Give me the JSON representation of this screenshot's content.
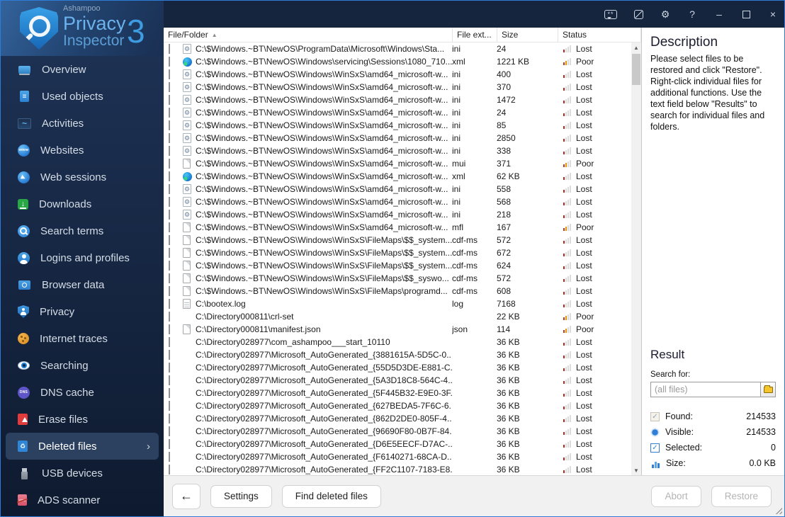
{
  "logo": {
    "brand_top": "Ashampoo",
    "brand_main": "Privacy",
    "brand_sub": "Inspector",
    "brand_version": "3"
  },
  "titlebar": {
    "feedback_glyph": "**",
    "settings_glyph": "⚙",
    "help_glyph": "?",
    "minimize_glyph": "–",
    "close_glyph": "×"
  },
  "sidebar": {
    "chevron": "›",
    "items": [
      {
        "label": "Overview",
        "icon": "laptop",
        "glyph": "",
        "selected": false
      },
      {
        "label": "Used objects",
        "icon": "docblue",
        "glyph": "",
        "selected": false
      },
      {
        "label": "Activities",
        "icon": "activities",
        "glyph": "",
        "selected": false
      },
      {
        "label": "Websites",
        "icon": "www",
        "glyph": "www",
        "selected": false
      },
      {
        "label": "Web sessions",
        "icon": "cursor",
        "glyph": "",
        "selected": false
      },
      {
        "label": "Downloads",
        "icon": "download",
        "glyph": "↓",
        "selected": false
      },
      {
        "label": "Search terms",
        "icon": "search-s",
        "glyph": "",
        "selected": false
      },
      {
        "label": "Logins and profiles",
        "icon": "person",
        "glyph": "",
        "selected": false
      },
      {
        "label": "Browser data",
        "icon": "camera",
        "glyph": "",
        "selected": false
      },
      {
        "label": "Privacy",
        "icon": "shield-p",
        "glyph": "",
        "selected": false
      },
      {
        "label": "Internet traces",
        "icon": "cookie",
        "glyph": "",
        "selected": false
      },
      {
        "label": "Searching",
        "icon": "eye",
        "glyph": "",
        "selected": false
      },
      {
        "label": "DNS cache",
        "icon": "dns",
        "glyph": "DNS",
        "selected": false
      },
      {
        "label": "Erase files",
        "icon": "erase",
        "glyph": "",
        "selected": false
      },
      {
        "label": "Deleted files",
        "icon": "trash-b",
        "glyph": "♻",
        "selected": true
      },
      {
        "label": "USB devices",
        "icon": "usb",
        "glyph": "",
        "selected": false
      },
      {
        "label": "ADS scanner",
        "icon": "ads",
        "glyph": "ADS",
        "selected": false
      }
    ]
  },
  "table": {
    "columns": [
      {
        "label": "File/Folder",
        "sort": "▲"
      },
      {
        "label": "File ext..."
      },
      {
        "label": "Size"
      },
      {
        "label": "Status"
      }
    ],
    "rows": [
      {
        "path": "C:\\$Windows.~BT\\NewOS\\ProgramData\\Microsoft\\Windows\\Sta...",
        "icon": "gear",
        "ext": "ini",
        "size": "24",
        "status": "Lost"
      },
      {
        "path": "C:\\$Windows.~BT\\NewOS\\Windows\\servicing\\Sessions\\1080_710...",
        "icon": "edge",
        "ext": "xml",
        "size": "1221 KB",
        "status": "Poor"
      },
      {
        "path": "C:\\$Windows.~BT\\NewOS\\Windows\\WinSxS\\amd64_microsoft-w...",
        "icon": "gear",
        "ext": "ini",
        "size": "400",
        "status": "Lost"
      },
      {
        "path": "C:\\$Windows.~BT\\NewOS\\Windows\\WinSxS\\amd64_microsoft-w...",
        "icon": "gear",
        "ext": "ini",
        "size": "370",
        "status": "Lost"
      },
      {
        "path": "C:\\$Windows.~BT\\NewOS\\Windows\\WinSxS\\amd64_microsoft-w...",
        "icon": "gear",
        "ext": "ini",
        "size": "1472",
        "status": "Lost"
      },
      {
        "path": "C:\\$Windows.~BT\\NewOS\\Windows\\WinSxS\\amd64_microsoft-w...",
        "icon": "gear",
        "ext": "ini",
        "size": "24",
        "status": "Lost"
      },
      {
        "path": "C:\\$Windows.~BT\\NewOS\\Windows\\WinSxS\\amd64_microsoft-w...",
        "icon": "gear",
        "ext": "ini",
        "size": "85",
        "status": "Lost"
      },
      {
        "path": "C:\\$Windows.~BT\\NewOS\\Windows\\WinSxS\\amd64_microsoft-w...",
        "icon": "gear",
        "ext": "ini",
        "size": "2850",
        "status": "Lost"
      },
      {
        "path": "C:\\$Windows.~BT\\NewOS\\Windows\\WinSxS\\amd64_microsoft-w...",
        "icon": "gear",
        "ext": "ini",
        "size": "338",
        "status": "Lost"
      },
      {
        "path": "C:\\$Windows.~BT\\NewOS\\Windows\\WinSxS\\amd64_microsoft-w...",
        "icon": "doc",
        "ext": "mui",
        "size": "371",
        "status": "Poor"
      },
      {
        "path": "C:\\$Windows.~BT\\NewOS\\Windows\\WinSxS\\amd64_microsoft-w...",
        "icon": "edge",
        "ext": "xml",
        "size": "62 KB",
        "status": "Lost"
      },
      {
        "path": "C:\\$Windows.~BT\\NewOS\\Windows\\WinSxS\\amd64_microsoft-w...",
        "icon": "gear",
        "ext": "ini",
        "size": "558",
        "status": "Lost"
      },
      {
        "path": "C:\\$Windows.~BT\\NewOS\\Windows\\WinSxS\\amd64_microsoft-w...",
        "icon": "gear",
        "ext": "ini",
        "size": "568",
        "status": "Lost"
      },
      {
        "path": "C:\\$Windows.~BT\\NewOS\\Windows\\WinSxS\\amd64_microsoft-w...",
        "icon": "gear",
        "ext": "ini",
        "size": "218",
        "status": "Lost"
      },
      {
        "path": "C:\\$Windows.~BT\\NewOS\\Windows\\WinSxS\\amd64_microsoft-w...",
        "icon": "doc",
        "ext": "mfl",
        "size": "167",
        "status": "Poor"
      },
      {
        "path": "C:\\$Windows.~BT\\NewOS\\Windows\\WinSxS\\FileMaps\\$$_system...",
        "icon": "doc",
        "ext": "cdf-ms",
        "size": "572",
        "status": "Lost"
      },
      {
        "path": "C:\\$Windows.~BT\\NewOS\\Windows\\WinSxS\\FileMaps\\$$_system...",
        "icon": "doc",
        "ext": "cdf-ms",
        "size": "672",
        "status": "Lost"
      },
      {
        "path": "C:\\$Windows.~BT\\NewOS\\Windows\\WinSxS\\FileMaps\\$$_system...",
        "icon": "doc",
        "ext": "cdf-ms",
        "size": "624",
        "status": "Lost"
      },
      {
        "path": "C:\\$Windows.~BT\\NewOS\\Windows\\WinSxS\\FileMaps\\$$_syswo...",
        "icon": "doc",
        "ext": "cdf-ms",
        "size": "572",
        "status": "Lost"
      },
      {
        "path": "C:\\$Windows.~BT\\NewOS\\Windows\\WinSxS\\FileMaps\\programd...",
        "icon": "doc",
        "ext": "cdf-ms",
        "size": "608",
        "status": "Lost"
      },
      {
        "path": "C:\\bootex.log",
        "icon": "log",
        "ext": "log",
        "size": "7168",
        "status": "Lost"
      },
      {
        "path": "C:\\Directory000811\\crl-set",
        "icon": "none",
        "ext": "",
        "size": "22 KB",
        "status": "Poor"
      },
      {
        "path": "C:\\Directory000811\\manifest.json",
        "icon": "doc",
        "ext": "json",
        "size": "114",
        "status": "Poor"
      },
      {
        "path": "C:\\Directory028977\\com_ashampoo___start_10110",
        "icon": "none",
        "ext": "",
        "size": "36 KB",
        "status": "Lost"
      },
      {
        "path": "C:\\Directory028977\\Microsoft_AutoGenerated_{3881615A-5D5C-0...",
        "icon": "none",
        "ext": "",
        "size": "36 KB",
        "status": "Lost"
      },
      {
        "path": "C:\\Directory028977\\Microsoft_AutoGenerated_{55D5D3DE-E881-C...",
        "icon": "none",
        "ext": "",
        "size": "36 KB",
        "status": "Lost"
      },
      {
        "path": "C:\\Directory028977\\Microsoft_AutoGenerated_{5A3D18C8-564C-4...",
        "icon": "none",
        "ext": "",
        "size": "36 KB",
        "status": "Lost"
      },
      {
        "path": "C:\\Directory028977\\Microsoft_AutoGenerated_{5F445B32-E9E0-3F...",
        "icon": "none",
        "ext": "",
        "size": "36 KB",
        "status": "Lost"
      },
      {
        "path": "C:\\Directory028977\\Microsoft_AutoGenerated_{627BEDA5-7F6C-6...",
        "icon": "none",
        "ext": "",
        "size": "36 KB",
        "status": "Lost"
      },
      {
        "path": "C:\\Directory028977\\Microsoft_AutoGenerated_{862D2DE0-805F-4...",
        "icon": "none",
        "ext": "",
        "size": "36 KB",
        "status": "Lost"
      },
      {
        "path": "C:\\Directory028977\\Microsoft_AutoGenerated_{96690F80-0B7F-84...",
        "icon": "none",
        "ext": "",
        "size": "36 KB",
        "status": "Lost"
      },
      {
        "path": "C:\\Directory028977\\Microsoft_AutoGenerated_{D6E5EECF-D7AC-...",
        "icon": "none",
        "ext": "",
        "size": "36 KB",
        "status": "Lost"
      },
      {
        "path": "C:\\Directory028977\\Microsoft_AutoGenerated_{F6140271-68CA-D...",
        "icon": "none",
        "ext": "",
        "size": "36 KB",
        "status": "Lost"
      },
      {
        "path": "C:\\Directory028977\\Microsoft_AutoGenerated_{FF2C1107-7183-E8...",
        "icon": "none",
        "ext": "",
        "size": "36 KB",
        "status": "Lost"
      }
    ]
  },
  "description": {
    "title": "Description",
    "body": "Please select files to be restored and click \"Restore\". Right-click individual files for additional functions. Use the text field below \"Results\" to search for individual files and folders."
  },
  "result": {
    "title": "Result",
    "search_label": "Search for:",
    "search_placeholder": "(all files)",
    "stats": [
      {
        "icon": "found",
        "glyph": "✓",
        "label": "Found:",
        "value": "214533"
      },
      {
        "icon": "visible",
        "glyph": "",
        "label": "Visible:",
        "value": "214533"
      },
      {
        "icon": "selected",
        "glyph": "✓",
        "label": "Selected:",
        "value": "0"
      },
      {
        "icon": "size",
        "glyph": "",
        "label": "Size:",
        "value": "0.0 KB"
      }
    ]
  },
  "footer": {
    "back_label": "←",
    "settings_label": "Settings",
    "find_label": "Find deleted files",
    "abort_label": "Abort",
    "restore_label": "Restore"
  }
}
